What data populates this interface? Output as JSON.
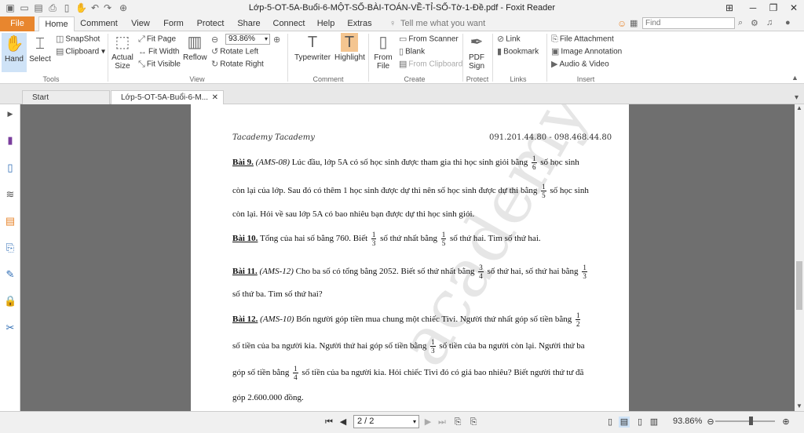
{
  "window": {
    "title": "Lớp-5-OT-5A-Buổi-6-MỘT-SỐ-BÀI-TOÁN-VỀ-TỈ-SỐ-Tờ-1-Đề.pdf - Foxit Reader"
  },
  "menu": {
    "file": "File",
    "tabs": [
      "Home",
      "Comment",
      "View",
      "Form",
      "Protect",
      "Share",
      "Connect",
      "Help",
      "Extras"
    ],
    "tell_me": "Tell me what you want to do...",
    "find_placeholder": "Find"
  },
  "ribbon": {
    "hand": "Hand",
    "select": "Select",
    "snapshot": "SnapShot",
    "clipboard": "Clipboard",
    "tools_group": "Tools",
    "actual_size_1": "Actual",
    "actual_size_2": "Size",
    "fit_page": "Fit Page",
    "fit_width": "Fit Width",
    "fit_visible": "Fit Visible",
    "reflow": "Reflow",
    "zoom": "93.86%",
    "rotate_left": "Rotate Left",
    "rotate_right": "Rotate Right",
    "view_group": "View",
    "typewriter": "Typewriter",
    "highlight": "Highlight",
    "comment_group": "Comment",
    "from_file_1": "From",
    "from_file_2": "File",
    "from_scanner": "From Scanner",
    "blank": "Blank",
    "from_clipboard": "From Clipboard",
    "create_group": "Create",
    "pdf_sign_1": "PDF",
    "pdf_sign_2": "Sign",
    "protect_group": "Protect",
    "link": "Link",
    "bookmark": "Bookmark",
    "links_group": "Links",
    "file_attachment": "File Attachment",
    "image_annotation": "Image Annotation",
    "audio_video": "Audio & Video",
    "insert_group": "Insert"
  },
  "tabs": {
    "start": "Start",
    "doc": "Lớp-5-OT-5A-Buổi-6-M..."
  },
  "document": {
    "header_left": "Tacademy Tacademy",
    "header_right": "091.201.44.80 - 098.468.44.80",
    "watermark": "academy",
    "p9_label": "Bài 9.",
    "p9_code": "(AMS-08)",
    "p9_l1a": "Lúc đầu, lớp 5A có số học sinh được tham gia thi học sinh giỏi bằng",
    "p9_l1b": "số học sinh",
    "p9_l2a": "còn lại của lớp. Sau đó có thêm 1 học sinh được dự thi nên số học sinh được dự thi bằng",
    "p9_l2b": "số học sinh",
    "p9_l3": "còn lại. Hỏi về sau lớp 5A có bao nhiêu bạn được dự thi học sinh giỏi.",
    "p10_label": "Bài 10.",
    "p10_a": "Tổng của hai số bằng 760. Biết",
    "p10_b": "số thứ nhất bằng",
    "p10_c": "số thứ hai. Tìm số thứ hai.",
    "p11_label": "Bài 11.",
    "p11_code": "(AMS-12)",
    "p11_a": "Cho ba số có tổng bằng 2052. Biết số thứ nhất bằng",
    "p11_b": "số thứ hai, số thứ hai bằng",
    "p11_l2": "số thứ ba. Tìm số thứ hai?",
    "p12_label": "Bài 12.",
    "p12_code": "(AMS-10)",
    "p12_a": "Bốn người góp tiền mua chung một chiếc Tivi. Người thứ nhất góp số tiền bằng",
    "p12_l2a": "số tiền của ba người kia. Người thứ hai góp số tiền bằng",
    "p12_l2b": "số tiền của ba người còn lại. Người thứ ba",
    "p12_l3a": "góp số tiền bằng",
    "p12_l3b": "số tiền của ba người kia. Hỏi chiếc Tivi đó có giá bao nhiêu? Biết người thứ tư đã",
    "p12_l4": "góp 2.600.000 đồng.",
    "one": "1",
    "three": "3",
    "four": "4",
    "five": "5",
    "six": "6",
    "two": "2"
  },
  "status": {
    "page": "2 / 2",
    "zoom": "93.86%"
  }
}
